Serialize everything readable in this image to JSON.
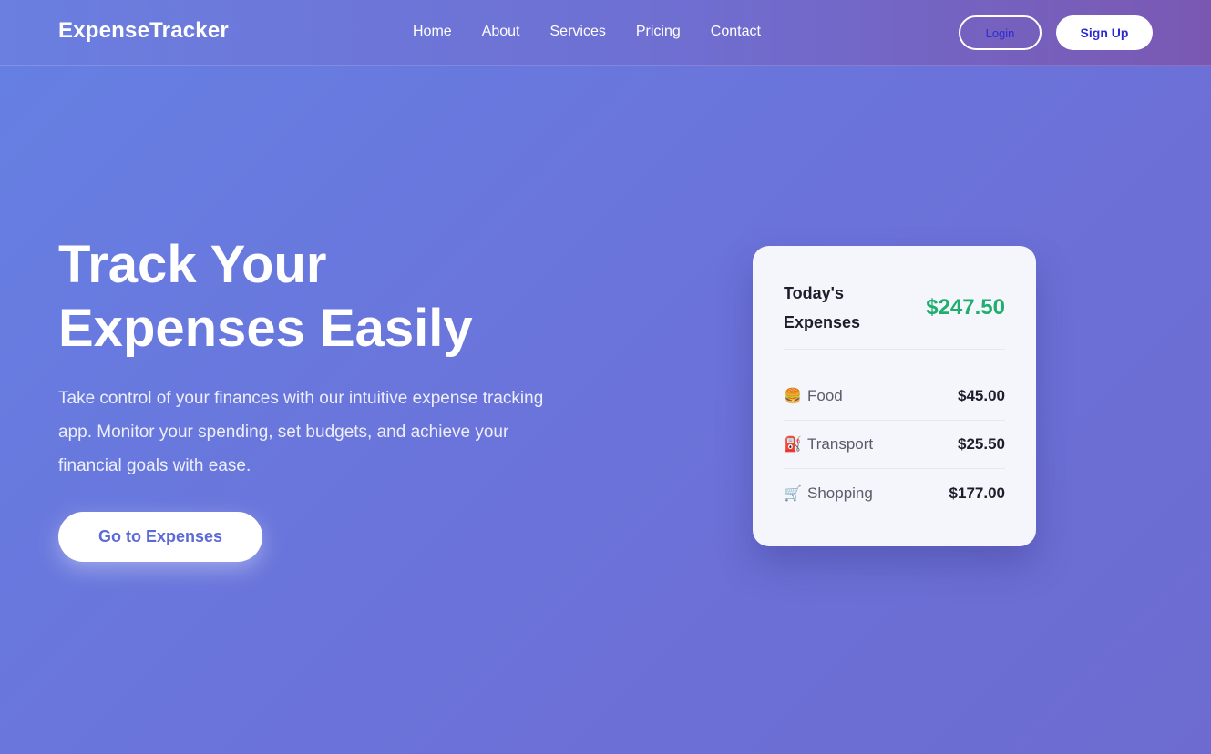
{
  "nav": {
    "brand": "ExpenseTracker",
    "links": [
      "Home",
      "About",
      "Services",
      "Pricing",
      "Contact"
    ],
    "login_label": "Login",
    "signup_label": "Sign Up"
  },
  "hero": {
    "title_line1": "Track Your",
    "title_line2": "Expenses Easily",
    "subtitle": "Take control of your finances with our intuitive expense tracking app. Monitor your spending, set budgets, and achieve your financial goals with ease.",
    "cta_label": "Go to Expenses"
  },
  "card": {
    "title": "Today's Expenses",
    "total": "$247.50",
    "items": [
      {
        "icon": "🍔",
        "icon_name": "burger-icon",
        "label": "Food",
        "amount": "$45.00"
      },
      {
        "icon": "⛽",
        "icon_name": "fuel-pump-icon",
        "label": "Transport",
        "amount": "$25.50"
      },
      {
        "icon": "🛒",
        "icon_name": "shopping-cart-icon",
        "label": "Shopping",
        "amount": "$177.00"
      }
    ]
  },
  "colors": {
    "accent_green": "#1fae6e",
    "button_text": "#2b2bd6",
    "cta_text": "#5b6ad6"
  }
}
